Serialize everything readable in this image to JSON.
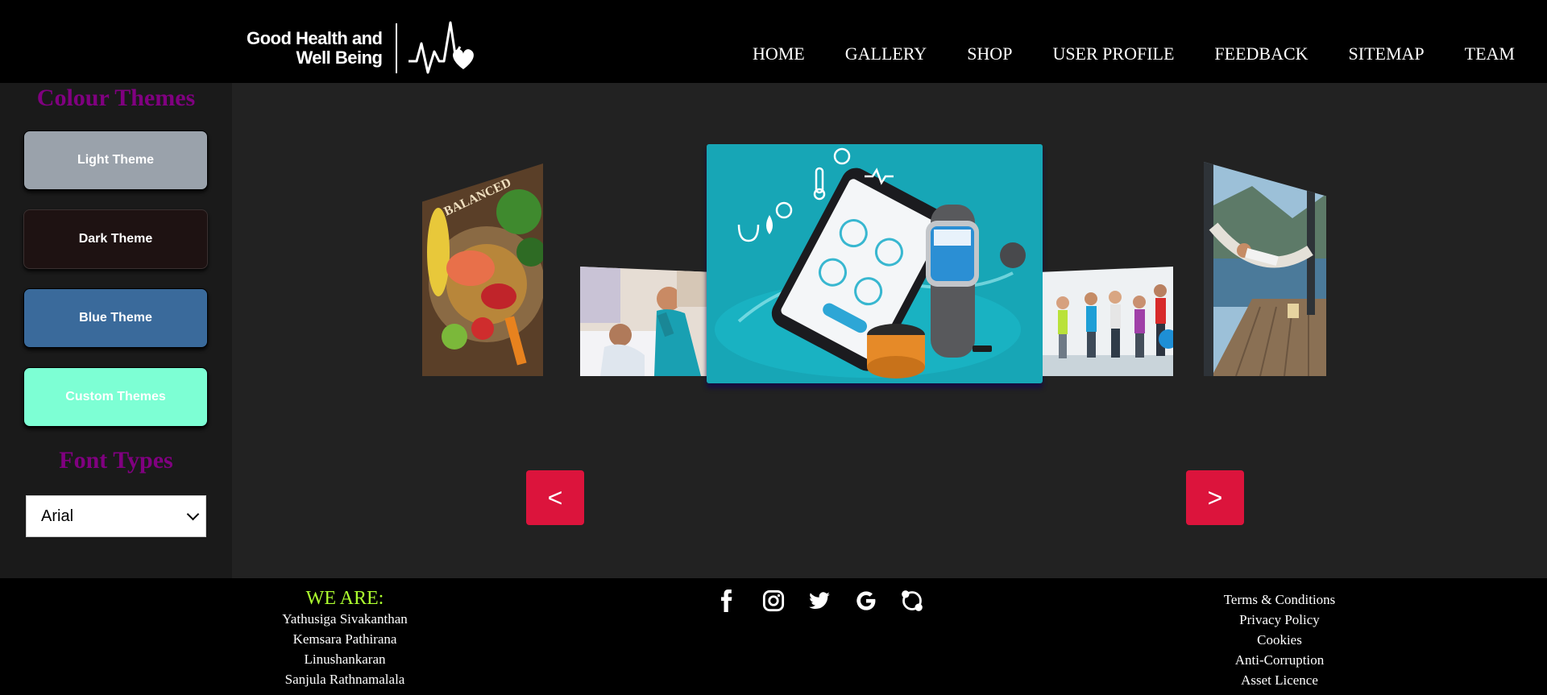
{
  "header": {
    "logo_line1": "Good Health and",
    "logo_line2": "Well Being",
    "nav": [
      "HOME",
      "GALLERY",
      "SHOP",
      "USER PROFILE",
      "FEEDBACK",
      "SITEMAP",
      "TEAM"
    ]
  },
  "sidebar": {
    "colour_heading": "Colour Themes",
    "themes": [
      {
        "label": "Light Theme",
        "color": "#9aa2ab"
      },
      {
        "label": "Dark Theme",
        "color": "#1e1212"
      },
      {
        "label": "Blue Theme",
        "color": "#3a6a9b"
      },
      {
        "label": "Custom Themes",
        "color": "#7dffd4"
      }
    ],
    "font_heading": "Font Types",
    "font_selected": "Arial"
  },
  "carousel": {
    "prev_label": "<",
    "next_label": ">",
    "images": [
      "balanced-diet-image",
      "nurse-patient-image",
      "health-tracking-devices-image",
      "group-exercise-image",
      "hammock-relaxing-image"
    ]
  },
  "footer": {
    "we_are_title": "WE ARE:",
    "members": [
      "Yathusiga Sivakanthan",
      "Kemsara Pathirana",
      "Linushankaran",
      "Sanjula Rathnamalala"
    ],
    "socials": [
      "facebook-icon",
      "instagram-icon",
      "twitter-icon",
      "google-icon",
      "skype-icon"
    ],
    "legal_links": [
      "Terms & Conditions",
      "Privacy Policy",
      "Cookies",
      "Anti-Corruption",
      "Asset Licence"
    ]
  },
  "colors": {
    "accent": "#dc143c",
    "heading": "#800080",
    "we_are": "#adff2f",
    "main_bg": "#222222",
    "sidebar_bg": "#1a1a1a"
  }
}
